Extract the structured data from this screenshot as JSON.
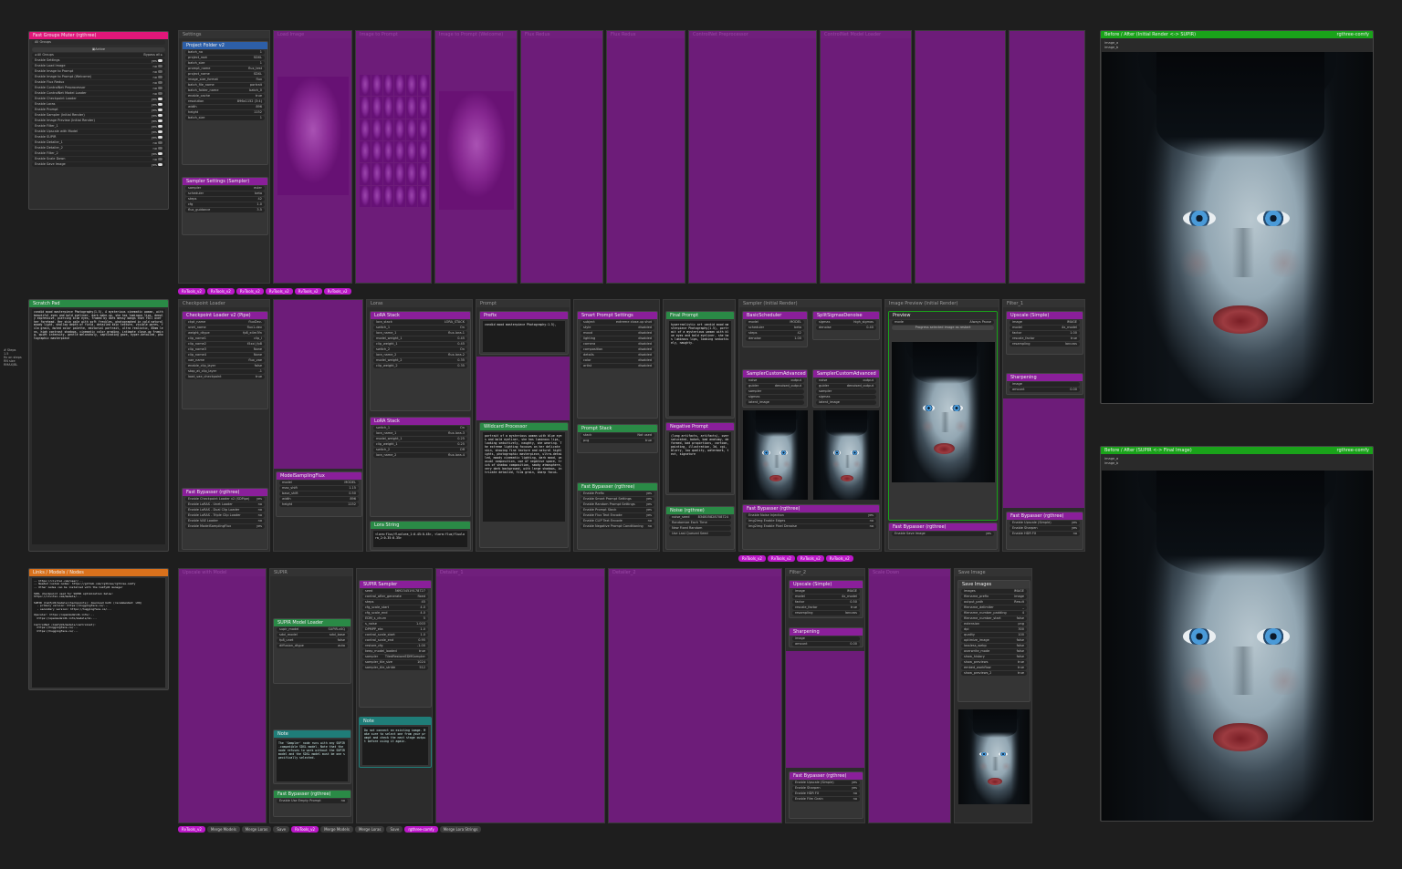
{
  "colors": {
    "bypass": "#9614aa",
    "pink": "#e0177a",
    "green": "#2a8a46",
    "orange": "#d9711c",
    "purple": "#8a1f9a",
    "blue": "#2d5fa8",
    "teal": "#1f7d78",
    "bright_green": "#1aa31a"
  },
  "control_panel": {
    "title": "Fast Groups Muter (rgthree)",
    "subtitle": "All Groups",
    "header_button": "Active",
    "nav_label": "All Groups",
    "nav_value": "Bypass all",
    "items": [
      {
        "label": "Enable Settings",
        "value": "yes"
      },
      {
        "label": "Enable Load Image",
        "value": "no"
      },
      {
        "label": "Enable Image to Prompt",
        "value": "no"
      },
      {
        "label": "Enable Image to Prompt (Welcome)",
        "value": "no"
      },
      {
        "label": "Enable Flux Redux",
        "value": "no"
      },
      {
        "label": "Enable ControlNet Preprocessor",
        "value": "no"
      },
      {
        "label": "Enable ControlNet Model Loader",
        "value": "no"
      },
      {
        "label": "Enable Checkpoint Loader",
        "value": "yes"
      },
      {
        "label": "Enable Loras",
        "value": "yes"
      },
      {
        "label": "Enable Prompt",
        "value": "yes"
      },
      {
        "label": "Enable Sampler (Initial Render)",
        "value": "yes"
      },
      {
        "label": "Enable Image Preview (Initial Render)",
        "value": "yes"
      },
      {
        "label": "Enable Filter_1",
        "value": "yes"
      },
      {
        "label": "Enable Upscale with Model",
        "value": "yes"
      },
      {
        "label": "Enable SUPIR",
        "value": "yes"
      },
      {
        "label": "Enable Detailer_1",
        "value": "no"
      },
      {
        "label": "Enable Detailer_2",
        "value": "no"
      },
      {
        "label": "Enable Filter_2",
        "value": "yes"
      },
      {
        "label": "Enable Scale Down",
        "value": "no"
      },
      {
        "label": "Enable Save Image",
        "value": "yes"
      }
    ]
  },
  "script_panel": {
    "title": "Scratch Pad",
    "text": "candid mood masterpiece Photography(1.5), A mysterious cinematic woman, with beautiful eyes and bold eyeliner, dark make-up, she has luminous lips, deeply expressive, piercing blue eyes, framed by dark messy bangs that fall over her forehead. Her skin pale with soft freckles, photographed in cold natural moody light, shallow depth of field, detailed skin texture, visible pores, film grain, muted color palette, editorial portrait, ultra realistic, 85mm lens, high contrast shadows, cinematic color grading, intimate close-up framing, quiet intensity, gentle melancholy, captivating gaze, hyper-detailed, photographic masterpiece"
  },
  "notes_panel": {
    "title": "Links / Models / Nodes",
    "text": "-- https://civitai.com/user/...\n-- Needed custom nodes: https://github.com/rgthree/rgthree-comfy\n-- Other nodes can be installed with the ComfyUI manager\n\nSDXL checkpoint used for SUPIR optimization below:\nhttps://civitai.com/models/...\n\nSUPIR (ComfyUI/models/checkpoints): download both (recommended: v0Q)\n  - primary version: https://huggingface.co/...\n  - secondary version: https://huggingface.co/...\n\nUpscaler: https://openmodeldb.info/...\n  https://openmodeldb.info/models/4x-...\n\nControlNet (ComfyUI/models/controlnet):\n  https://huggingface.co/...\n  https://huggingface.co/..."
  },
  "side_label": "# Steps\n1.5\nfix on steps\nRN size\nRMAX/BL",
  "groups": [
    {
      "label": "Settings"
    },
    {
      "label": "Load Image"
    },
    {
      "label": "Image to Prompt"
    },
    {
      "label": "Image to Prompt (Welcome)"
    },
    {
      "label": "Flux Redux"
    },
    {
      "label": "Flux Redux"
    },
    {
      "label": "ControlNet Preprocessor"
    },
    {
      "label": "ControlNet Model Loader"
    },
    {
      "label": "Checkpoint Loader"
    },
    {
      "label": "Loras"
    },
    {
      "label": "Prompt"
    },
    {
      "label": "Sampler (Initial Render)"
    },
    {
      "label": "Image Preview (Initial Render)"
    },
    {
      "label": "Filter_1"
    },
    {
      "label": "Upscale with Model"
    },
    {
      "label": "SUPIR"
    },
    {
      "label": "Detailer_1"
    },
    {
      "label": "Detailer_2"
    },
    {
      "label": "Filter_2"
    },
    {
      "label": "Scale Down"
    },
    {
      "label": "Save Image"
    }
  ],
  "nodes": {
    "project_folder": {
      "title": "Project Folder v2",
      "badge": "RvTools_v2",
      "widgets": [
        [
          "batch_no",
          "1"
        ],
        [
          "project_root",
          "SDXL"
        ],
        [
          "batch_size",
          "1"
        ],
        [
          "prompt_name",
          "flux_test"
        ]
      ]
    },
    "size": {
      "widgets": [
        [
          "project_name",
          "SDXL"
        ],
        [
          "image_size_format",
          "flux"
        ],
        [
          "batch_file_name",
          "portrait"
        ],
        [
          "batch_folder_name",
          "batch_0"
        ],
        [
          "enable_cache",
          "true"
        ],
        [
          "resolution",
          "896x1152 (3:4)"
        ],
        [
          "width",
          "896"
        ],
        [
          "height",
          "1152"
        ],
        [
          "batch_size",
          "1"
        ]
      ]
    },
    "sampler_settings": {
      "title": "Sampler Settings (Sampler)",
      "widgets": [
        [
          "sampler",
          "euler"
        ],
        [
          "scheduler",
          "beta"
        ],
        [
          "steps",
          "42"
        ],
        [
          "cfg",
          "1.0"
        ],
        [
          "flux_guidance",
          "3.5"
        ]
      ]
    },
    "checkpoint_loader": {
      "title": "Checkpoint Loader v2 (Pipe)",
      "widgets": [
        [
          "ckpt_name",
          "fluxDev-"
        ],
        [
          "unet_name",
          "flux1-dev"
        ],
        [
          "weight_dtype",
          "fp8_e4m3fn"
        ],
        [
          "clip_name1",
          "clip_l"
        ],
        [
          "clip_name2",
          "t5xxl_fp8"
        ],
        [
          "clip_name3",
          "None"
        ],
        [
          "clip_name4",
          "None"
        ],
        [
          "vae_name",
          "flux_vae"
        ],
        [
          "enable_clip_layer",
          "false"
        ],
        [
          "stop_at_clip_layer",
          "-1"
        ],
        [
          "load_vae_checkpoint",
          "true"
        ]
      ]
    },
    "lora_stack_1": {
      "title": "LoRA Stack",
      "widgets": [
        [
          "lora_stack",
          "LORA_STACK"
        ],
        [
          "switch_1",
          "On"
        ],
        [
          "lora_name_1",
          "flux-lora-1"
        ],
        [
          "model_weight_1",
          "0.45"
        ],
        [
          "clip_weight_1",
          "0.45"
        ],
        [
          "switch_2",
          "On"
        ],
        [
          "lora_name_2",
          "flux-lora-2"
        ],
        [
          "model_weight_2",
          "0.35"
        ],
        [
          "clip_weight_2",
          "0.35"
        ]
      ]
    },
    "lora_stack_2": {
      "title": "LoRA Stack",
      "widgets": [
        [
          "switch_1",
          "On"
        ],
        [
          "lora_name_1",
          "flux-lora-3"
        ],
        [
          "model_weight_1",
          "0.25"
        ],
        [
          "clip_weight_1",
          "0.25"
        ],
        [
          "switch_2",
          "Off"
        ],
        [
          "lora_name_2",
          "flux-lora-4"
        ]
      ]
    },
    "prefix": {
      "title": "Prefix",
      "text": "candid mood masterpiece Photography:1.5),"
    },
    "wildcard_processor": {
      "title": "Wildcard Processor",
      "text": "portrait of a mysterious woman with blue eyes and bold eyeliner, she has luminous lips, looking seductively, naughty, she wearing. The extreme lighting focuses on her delicate skin, showing fine texture and natural highlights, photographic masterpiece, ultra-detailed, moody cinematic lighting, dark mood, unusual composition, use of negative space, trick of shadow composition, smoky atmosphere, very dark background, with large shadows, intricate detailed, film grain, sharp focus."
    },
    "prompt_stack": {
      "title": "Prompt Stack",
      "widgets": [
        [
          "stack",
          "Not used"
        ],
        [
          "pcg",
          "true"
        ]
      ]
    },
    "negative_prompt": {
      "title": "Negative Prompt",
      "text": "(long artifacts, artifacts), oversaturated, bokeh, bad anatomy, deformed, bad proportions, cartoon, painting, illustration, 3d, cgi, blurry, low quality, watermark, text, signature"
    },
    "smart_prompt": {
      "title": "Smart Prompt Settings",
      "widgets": [
        [
          "subject",
          "extreme close-up shot"
        ],
        [
          "style",
          "disabled"
        ],
        [
          "mood",
          "disabled"
        ],
        [
          "lighting",
          "disabled"
        ],
        [
          "camera",
          "disabled"
        ],
        [
          "composition",
          "disabled"
        ],
        [
          "details",
          "disabled"
        ],
        [
          "color",
          "disabled"
        ],
        [
          "artist",
          "disabled"
        ]
      ]
    },
    "final_prompt": {
      "title": "Final Prompt",
      "text": "hyperrealistic art candid mood masterpiece Photography(1.5), portrait of a mysterious woman with blue eyes and bold eyeliner, she has luminous lips, looking seductively, naughty."
    },
    "basic_scheduler": {
      "title": "BasicScheduler",
      "widgets": [
        [
          "model",
          "MODEL"
        ],
        [
          "scheduler",
          "beta"
        ],
        [
          "steps",
          "42"
        ],
        [
          "denoise",
          "1.00"
        ]
      ]
    },
    "split_sigmas": {
      "title": "SplitSigmasDenoise",
      "widgets": [
        [
          "sigmas",
          "high_sigmas"
        ],
        [
          "denoise",
          "0.40"
        ]
      ]
    },
    "sampler_custom_1": {
      "title": "SamplerCustomAdvanced",
      "widgets": [
        [
          "noise",
          "output"
        ],
        [
          "guider",
          "denoised_output"
        ],
        [
          "sampler",
          ""
        ],
        [
          "sigmas",
          ""
        ],
        [
          "latent_image",
          ""
        ]
      ]
    },
    "sampler_custom_2": {
      "title": "SamplerCustomAdvanced",
      "widgets": [
        [
          "noise",
          "output"
        ],
        [
          "guider",
          "denoised_output"
        ],
        [
          "sampler",
          ""
        ],
        [
          "sigmas",
          ""
        ],
        [
          "latent_image",
          ""
        ]
      ]
    },
    "preview": {
      "title": "Preview",
      "mode_label": "Always Pause",
      "caption": "Progress selected image as restart"
    },
    "upscale_model": {
      "title": "Upscale (Simple)",
      "widgets": [
        [
          "image",
          "IMAGE"
        ],
        [
          "model",
          "4x_model"
        ],
        [
          "factor",
          "1.00"
        ],
        [
          "rescale_factor",
          "true"
        ],
        [
          "resampling",
          "lanczos"
        ]
      ]
    },
    "sharpening": {
      "title": "Sharpening",
      "widgets": [
        [
          "image",
          ""
        ],
        [
          "amount",
          "0.00"
        ]
      ]
    },
    "supir_loader": {
      "title": "SUPIR Model Loader",
      "widgets": [
        [
          "supir_model",
          "SUPIR-v0Q"
        ],
        [
          "sdxl_model",
          "sdxl_base"
        ],
        [
          "fp8_unet",
          "false"
        ],
        [
          "diffusion_dtype",
          "auto"
        ]
      ]
    },
    "supir_sampler": {
      "title": "SUPIR Sampler",
      "widgets": [
        [
          "seed",
          "569234519178727"
        ],
        [
          "control_after_generate",
          "fixed"
        ],
        [
          "steps",
          "45"
        ],
        [
          "cfg_scale_start",
          "4.0"
        ],
        [
          "cfg_scale_end",
          "4.0"
        ],
        [
          "EDM_s_churn",
          "5"
        ],
        [
          "s_noise",
          "1.003"
        ],
        [
          "DPMPP_eta",
          "1.0"
        ],
        [
          "control_scale_start",
          "1.0"
        ],
        [
          "control_scale_end",
          "0.95"
        ],
        [
          "restore_cfg",
          "-1.00"
        ],
        [
          "keep_model_loaded",
          "true"
        ],
        [
          "sampler",
          "TiledRestoreEDMSampler"
        ],
        [
          "sampler_tile_size",
          "1024"
        ],
        [
          "sampler_tile_stride",
          "512"
        ]
      ]
    },
    "note_1": {
      "title": "Note",
      "text": "The 'Sampler' node runs with any SUPIR-compatible SDXL model. Note that the node refuses to work without the SUPIR model and the SDXL model must be one specifically selected."
    },
    "note_2": {
      "title": "Note",
      "text": "Do not connect an existing image. Make sure to select one from your prompt and check the next stage output before using it again."
    },
    "tiles": {
      "title": "Save Images",
      "widgets": [
        [
          "images",
          "IMAGE"
        ],
        [
          "filename_prefix",
          "image"
        ],
        [
          "output_path",
          "Result"
        ],
        [
          "filename_delimiter",
          "_"
        ],
        [
          "filename_number_padding",
          "4"
        ],
        [
          "filename_number_start",
          "false"
        ],
        [
          "extension",
          "png"
        ],
        [
          "dpi",
          "300"
        ],
        [
          "quality",
          "100"
        ],
        [
          "optimize_image",
          "false"
        ],
        [
          "lossless_webp",
          "false"
        ],
        [
          "overwrite_mode",
          "false"
        ],
        [
          "show_history",
          "false"
        ],
        [
          "show_previews",
          "true"
        ],
        [
          "embed_workflow",
          "true"
        ],
        [
          "show_previews_2",
          "true"
        ]
      ]
    },
    "upscale_b": {
      "title": "Upscale (Simple)",
      "widgets": [
        [
          "image",
          "IMAGE"
        ],
        [
          "model",
          "4x_model"
        ],
        [
          "factor",
          "0.50"
        ],
        [
          "rescale_factor",
          "true"
        ],
        [
          "resampling",
          "lanczos"
        ]
      ]
    },
    "bypasser_settings": {
      "title": "Fast Bypasser (rgthree)",
      "widgets": [
        [
          "Enable Checkpoint Loader v2 (SDPipe)",
          "yes"
        ],
        [
          "Enable LoRAS - Unet Loader",
          "no"
        ],
        [
          "Enable LoRAS - Dual Clip Loader",
          "no"
        ],
        [
          "Enable LoRAS - Triple Clip Loader",
          "no"
        ],
        [
          "Enable VAE Loader",
          "no"
        ],
        [
          "Enable ModelSamplingFlux",
          "yes"
        ]
      ]
    },
    "bypasser_prompt": {
      "title": "Fast Bypasser (rgthree)",
      "widgets": [
        [
          "Enable Prefix",
          "yes"
        ],
        [
          "Enable Smart Prompt Settings",
          "yes"
        ],
        [
          "Enable Random Prompt Settings",
          "yes"
        ],
        [
          "Enable Prompt Stack",
          "yes"
        ],
        [
          "Enable Flux Text Encode",
          "yes"
        ],
        [
          "Enable CLIP Text Encode",
          "no"
        ],
        [
          "Enable Negative Prompt Conditioning",
          "no"
        ]
      ]
    },
    "bypasser_sampler": {
      "title": "Fast Bypasser (rgthree)",
      "widgets": [
        [
          "Enable Noise Injection",
          "yes"
        ],
        [
          "Img2img Enable Edges",
          "no"
        ],
        [
          "Img2img Enable Pixel Denoise",
          "no"
        ]
      ]
    },
    "bypasser_preview": {
      "title": "Fast Bypasser (rgthree)",
      "widgets": [
        [
          "Enable Save Image",
          "yes"
        ]
      ]
    },
    "bypasser_upscale": {
      "title": "Fast Bypasser (rgthree)",
      "widgets": [
        [
          "Enable Upscale (Simple)",
          "yes"
        ],
        [
          "Enable Sharpen",
          "yes"
        ],
        [
          "Enable HDR FX",
          "no"
        ]
      ]
    },
    "bypasser_detail": {
      "title": "Fast Bypasser (rgthree)",
      "widgets": [
        [
          "Enable Upscale (Simple)",
          "yes"
        ],
        [
          "Enable Sharpen",
          "yes"
        ],
        [
          "Enable HDR FX",
          "no"
        ],
        [
          "Enable Film Grain",
          "no"
        ]
      ]
    },
    "bypasser_supir": {
      "title": "Fast Bypasser (rgthree)",
      "widgets": [
        [
          "Enable Use Empty Prompt",
          "no"
        ]
      ]
    },
    "random_noise": {
      "title": "Noise (rgthree)",
      "widgets": [
        [
          "noise_seed",
          "834805828708724"
        ],
        [
          "Randomize Each Time",
          ""
        ],
        [
          "New Fixed Random",
          ""
        ],
        [
          "Use Last Queued Seed",
          ""
        ]
      ]
    },
    "model_sampling": {
      "title": "ModelSamplingFlux",
      "widgets": [
        [
          "model",
          "MODEL"
        ],
        [
          "max_shift",
          "1.15"
        ],
        [
          "base_shift",
          "0.50"
        ],
        [
          "width",
          "896"
        ],
        [
          "height",
          "1152"
        ]
      ]
    },
    "lora_string": {
      "title": "Lora String",
      "text": "<lora:flux/fluxlora_1:0.45:0.45>, <lora:flux/fluxlora_2:0.35:0.35>"
    }
  },
  "comparer_top": {
    "title": "Before / After (Initial Render <-> SUPIR)",
    "badge": "rgthree-comfy",
    "inputs": [
      "image_a",
      "image_b"
    ]
  },
  "comparer_bottom": {
    "title": "Before / After (SUPIR <-> Final Image)",
    "badge": "rgthree-comfy",
    "inputs": [
      "image_a",
      "image_b"
    ]
  },
  "badges": {
    "rv": "RvTools_v2",
    "comfyui_impact": "comfyui-impact-pack",
    "comfyui_custom": "comfyui-custom-scripts",
    "rgthree": "rgthree-comfy",
    "supir": "comfyui-supir",
    "essentials": "comfyui_essentials",
    "easy": "comfyui-easy-use",
    "kjnodes": "comfyui-kjnodes",
    "cg": "Comfyroll_CustomNodes"
  },
  "bottom_tags": [
    "Merge Models",
    "Merge Loras",
    "Merge Lora Strings",
    "Save",
    "CLIP Skip",
    "VAE",
    "Model"
  ]
}
